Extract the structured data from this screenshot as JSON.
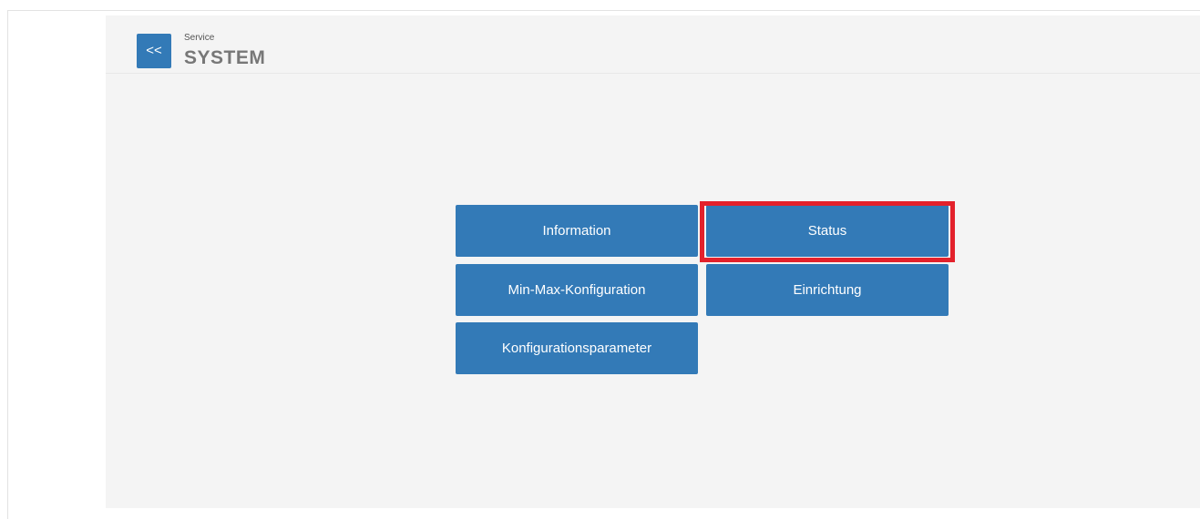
{
  "header": {
    "back_label": "<<",
    "breadcrumb": "Service",
    "title": "SYSTEM"
  },
  "menu": {
    "items": [
      {
        "label": "Information"
      },
      {
        "label": "Status",
        "highlighted": true
      },
      {
        "label": "Min-Max-Konfiguration"
      },
      {
        "label": "Einrichtung"
      },
      {
        "label": "Konfigurationsparameter"
      }
    ]
  },
  "colors": {
    "button_bg": "#337ab7",
    "highlight": "#e3212b",
    "panel_bg": "#f4f4f4"
  }
}
